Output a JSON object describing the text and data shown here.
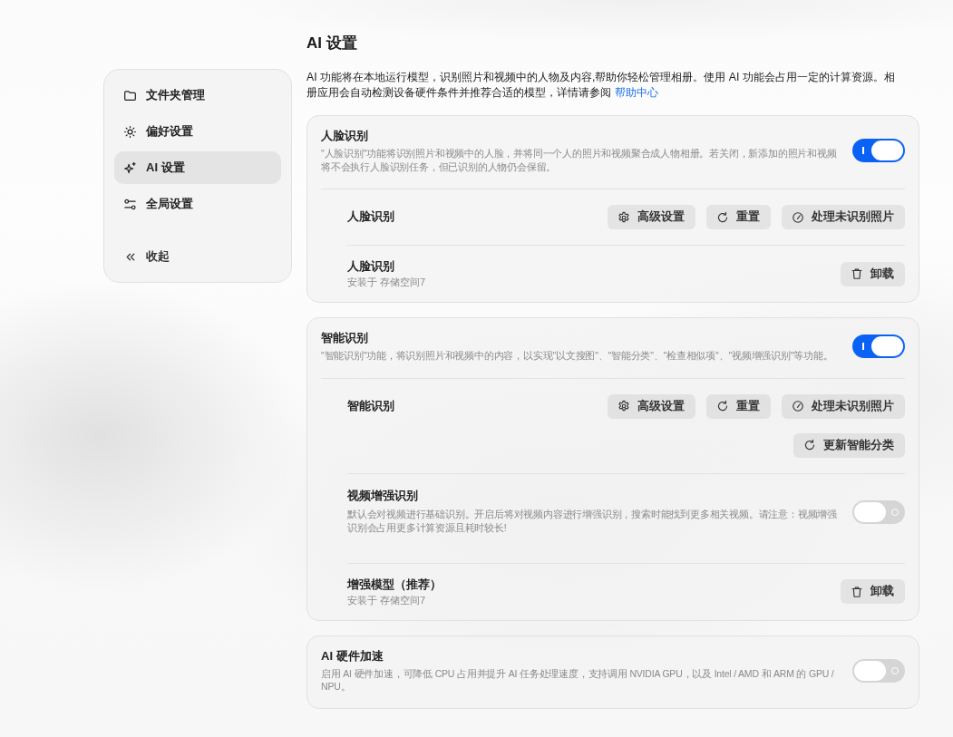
{
  "sidebar": {
    "items": [
      {
        "kind": "folder",
        "label": "文件夹管理",
        "selected": false
      },
      {
        "kind": "preferences",
        "label": "偏好设置",
        "selected": false
      },
      {
        "kind": "ai",
        "label": "AI 设置",
        "selected": true
      },
      {
        "kind": "global",
        "label": "全局设置",
        "selected": false
      }
    ],
    "collapse": {
      "label": "收起"
    }
  },
  "header": {
    "title": "AI 设置",
    "description": "AI 功能将在本地运行模型，识别照片和视频中的人物及内容,帮助你轻松管理相册。使用 AI 功能会占用一定的计算资源。相册应用会自动检测设备硬件条件并推荐合适的模型，详情请参阅",
    "link": "帮助中心"
  },
  "sections": [
    {
      "title": "人脸识别",
      "description": "\"人脸识别\"功能将识别照片和视频中的人脸，并将同一个人的照片和视频聚合成人物相册。若关闭，新添加的照片和视频将不会执行人脸识别任务，但已识别的人物仍会保留。",
      "toggle": {
        "on": true
      },
      "rows": [
        {
          "kind": "actions",
          "label": "人脸识别",
          "button_rows": [
            [
              {
                "kind": "settings",
                "label": "高级设置"
              },
              {
                "kind": "reset",
                "label": "重置"
              },
              {
                "kind": "process",
                "label": "处理未识别照片"
              }
            ]
          ]
        },
        {
          "kind": "model",
          "label": "人脸识别",
          "detail": "安装于 存储空间7",
          "button": {
            "kind": "uninstall",
            "label": "卸载"
          }
        }
      ]
    },
    {
      "title": "智能识别",
      "description": "\"智能识别\"功能，将识别照片和视频中的内容，以实现\"以文搜图\"、\"智能分类\"、\"检查相似项\"、\"视频增强识别\"等功能。",
      "toggle": {
        "on": true
      },
      "rows": [
        {
          "kind": "actions",
          "label": "智能识别",
          "button_rows": [
            [
              {
                "kind": "settings",
                "label": "高级设置"
              },
              {
                "kind": "reset",
                "label": "重置"
              },
              {
                "kind": "process",
                "label": "处理未识别照片"
              }
            ],
            [
              {
                "kind": "refresh",
                "label": "更新智能分类"
              }
            ]
          ]
        },
        {
          "kind": "option",
          "label": "视频增强识别",
          "description": "默认会对视频进行基础识别。开启后将对视频内容进行增强识别，搜索时能找到更多相关视频。请注意：视频增强识别会占用更多计算资源且耗时较长!",
          "toggle": {
            "on": false
          }
        },
        {
          "kind": "model",
          "label": "增强模型（推荐）",
          "detail": "安装于 存储空间7",
          "button": {
            "kind": "uninstall",
            "label": "卸载"
          }
        }
      ]
    },
    {
      "title": "AI 硬件加速",
      "description": "启用 AI 硬件加速，可降低 CPU 占用并提升 AI 任务处理速度，支持调用 NVIDIA GPU，以及 Intel / AMD 和 ARM 的 GPU / NPU。",
      "toggle": {
        "on": false
      }
    }
  ]
}
